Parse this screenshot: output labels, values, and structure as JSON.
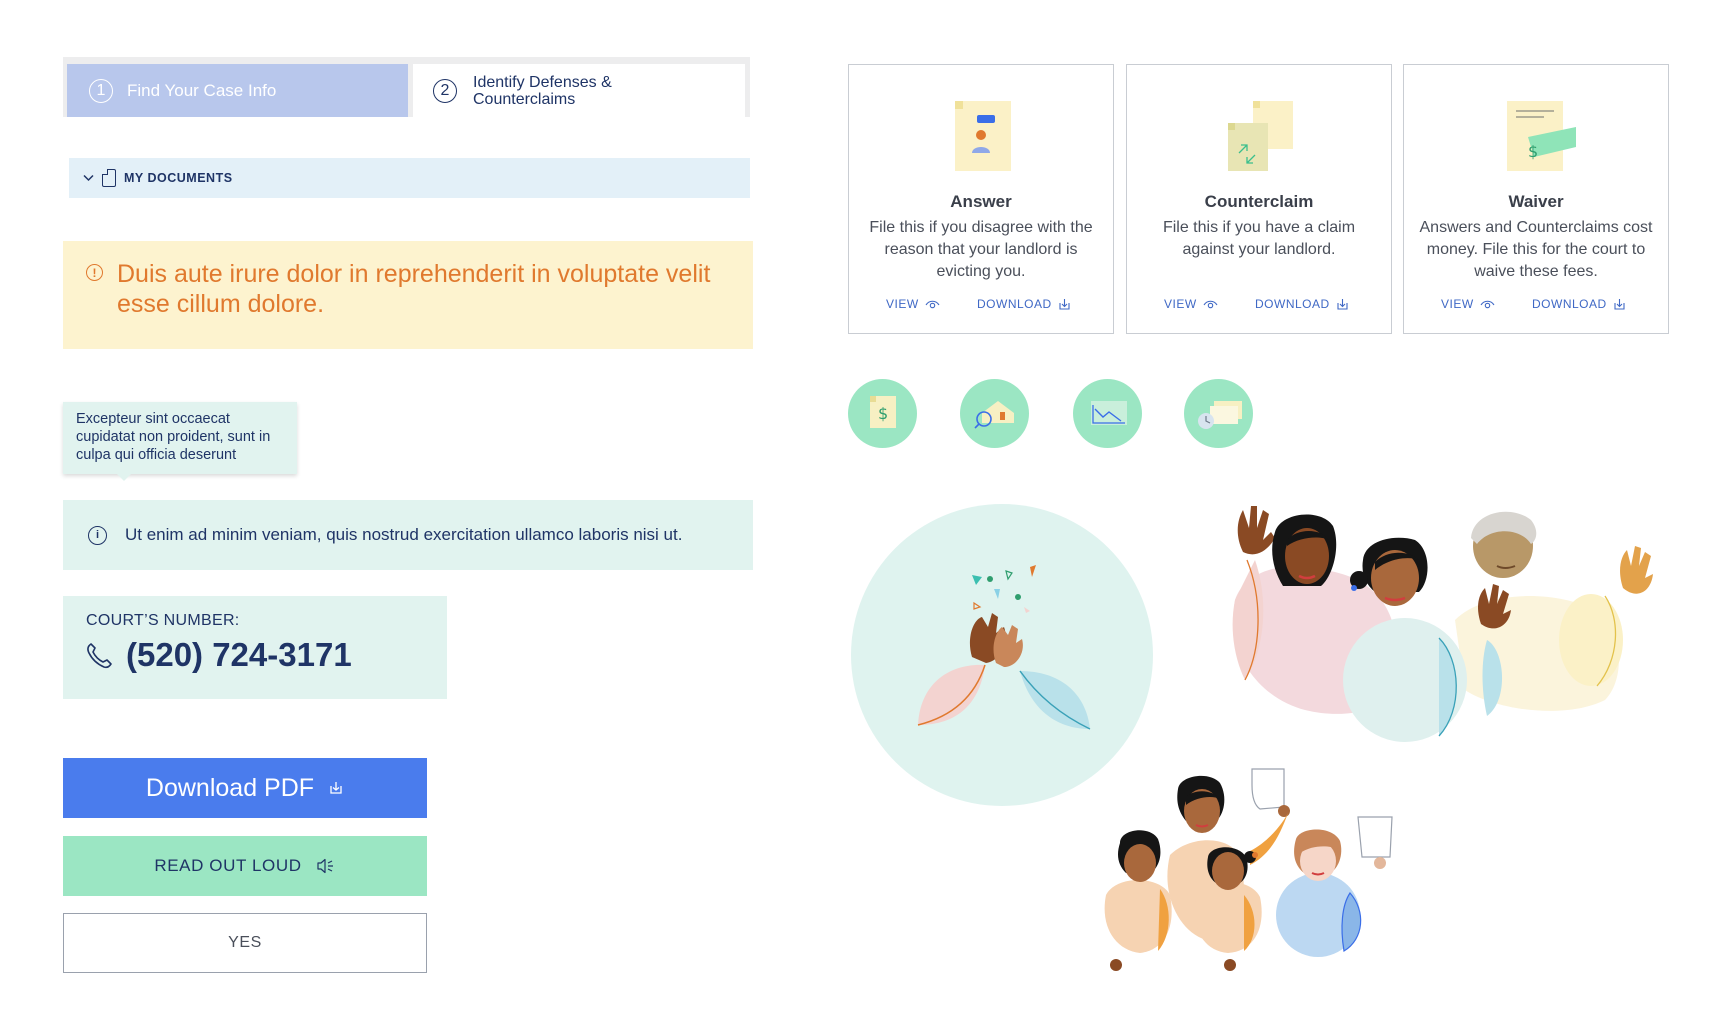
{
  "stepper": {
    "step1": {
      "number": "1",
      "label": "Find Your Case Info"
    },
    "step2": {
      "number": "2",
      "label": "Identify Defenses & Counterclaims"
    }
  },
  "my_documents": {
    "label": "MY DOCUMENTS",
    "icons": [
      "chevron-down-icon",
      "document-icon"
    ]
  },
  "warning": {
    "text": "Duis aute irure dolor in reprehenderit in voluptate velit esse cillum dolore.",
    "icon": "exclamation-circle-icon"
  },
  "tooltip": {
    "text": "Excepteur sint occaecat cupidatat non proident, sunt in culpa qui officia deserunt"
  },
  "info": {
    "text": "Ut enim ad minim veniam, quis nostrud exercitation ullamco laboris nisi ut.",
    "icon": "info-circle-icon"
  },
  "court": {
    "label": "COURT’S NUMBER:",
    "number": "(520) 724-3171",
    "icon": "phone-icon"
  },
  "buttons": {
    "download_pdf": "Download PDF",
    "read_out_loud": "READ OUT LOUD",
    "yes": "YES"
  },
  "cards": [
    {
      "title": "Answer",
      "description": "File this if you disagree with the reason that your landlord is evicting you.",
      "view": "VIEW",
      "download": "DOWNLOAD"
    },
    {
      "title": "Counterclaim",
      "description": "File this if you have a claim against your landlord.",
      "view": "VIEW",
      "download": "DOWNLOAD"
    },
    {
      "title": "Waiver",
      "description": "Answers and Counterclaims cost money. File this for the court to waive these fees.",
      "view": "VIEW",
      "download": "DOWNLOAD"
    }
  ],
  "round_icons": [
    "money-document-icon",
    "house-search-icon",
    "chart-down-icon",
    "clock-screen-icon"
  ],
  "colors": {
    "navy": "#1f3466",
    "blue_button": "#4a7ced",
    "mint": "#9be6c3",
    "light_mint": "#e1f3ef",
    "warning_bg": "#fdf3cf",
    "warning_text": "#e0792e",
    "step_active": "#b8c7ec",
    "link_blue": "#3f68c5"
  }
}
